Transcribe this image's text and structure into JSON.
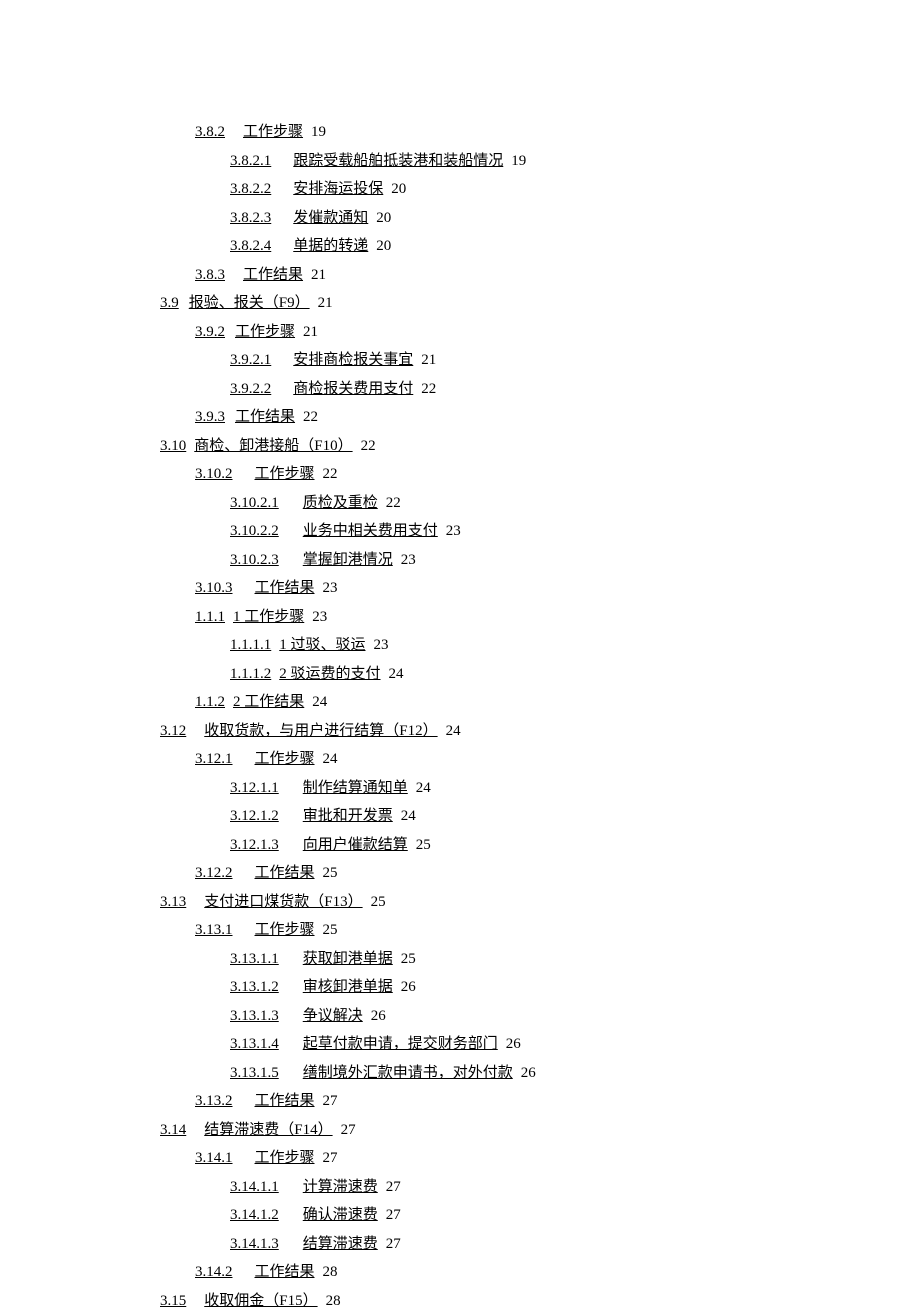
{
  "toc": [
    {
      "indent": 1,
      "num": "3.8.2",
      "gap": 18,
      "label": "工作步骤",
      "page": "19"
    },
    {
      "indent": 2,
      "num": "3.8.2.1",
      "gap": 22,
      "label": "跟踪受载船舶抵装港和装船情况",
      "page": "19"
    },
    {
      "indent": 2,
      "num": "3.8.2.2",
      "gap": 22,
      "label": "安排海运投保",
      "page": "20"
    },
    {
      "indent": 2,
      "num": "3.8.2.3",
      "gap": 22,
      "label": "发催款通知",
      "page": "20"
    },
    {
      "indent": 2,
      "num": "3.8.2.4",
      "gap": 22,
      "label": "单据的转递",
      "page": "20"
    },
    {
      "indent": 1,
      "num": "3.8.3",
      "gap": 18,
      "label": "工作结果",
      "page": "21"
    },
    {
      "indent": 0,
      "num": "3.9",
      "gap": 10,
      "label": "报验、报关（F9）",
      "page": "21"
    },
    {
      "indent": 1,
      "num": "3.9.2",
      "gap": 10,
      "label": "工作步骤",
      "page": "21"
    },
    {
      "indent": 2,
      "num": "3.9.2.1",
      "gap": 22,
      "label": "安排商检报关事宜",
      "page": "21"
    },
    {
      "indent": 2,
      "num": "3.9.2.2",
      "gap": 22,
      "label": "商检报关费用支付",
      "page": "22"
    },
    {
      "indent": 1,
      "num": "3.9.3",
      "gap": 10,
      "label": "工作结果",
      "page": "22"
    },
    {
      "indent": 0,
      "num": "3.10",
      "gap": 8,
      "label": "商检、卸港接船（F10）",
      "page": "22"
    },
    {
      "indent": 1,
      "num": "3.10.2",
      "gap": 22,
      "label": "工作步骤",
      "page": "22"
    },
    {
      "indent": 2,
      "num": "3.10.2.1",
      "gap": 24,
      "label": "质检及重检",
      "page": "22"
    },
    {
      "indent": 2,
      "num": "3.10.2.2",
      "gap": 24,
      "label": "业务中相关费用支付",
      "page": "23"
    },
    {
      "indent": 2,
      "num": "3.10.2.3",
      "gap": 24,
      "label": "掌握卸港情况",
      "page": "23"
    },
    {
      "indent": 1,
      "num": "3.10.3",
      "gap": 22,
      "label": "工作结果",
      "page": "23"
    },
    {
      "indent": 1,
      "num": "1.1.1",
      "gap": 8,
      "label": "1 工作步骤",
      "page": "23"
    },
    {
      "indent": 2,
      "num": "1.1.1.1",
      "gap": 8,
      "label": "1 过驳、驳运",
      "page": "23"
    },
    {
      "indent": 2,
      "num": "1.1.1.2",
      "gap": 8,
      "label": "2 驳运费的支付",
      "page": "24"
    },
    {
      "indent": 1,
      "num": "1.1.2",
      "gap": 8,
      "label": "2 工作结果",
      "page": "24"
    },
    {
      "indent": 0,
      "num": "3.12",
      "gap": 18,
      "label": "收取货款，与用户进行结算（F12）",
      "page": "24"
    },
    {
      "indent": 1,
      "num": "3.12.1",
      "gap": 22,
      "label": "工作步骤",
      "page": "24"
    },
    {
      "indent": 2,
      "num": "3.12.1.1",
      "gap": 24,
      "label": "制作结算通知单",
      "page": "24"
    },
    {
      "indent": 2,
      "num": "3.12.1.2",
      "gap": 24,
      "label": "审批和开发票",
      "page": "24"
    },
    {
      "indent": 2,
      "num": "3.12.1.3",
      "gap": 24,
      "label": "向用户催款结算",
      "page": "25"
    },
    {
      "indent": 1,
      "num": "3.12.2",
      "gap": 22,
      "label": "工作结果",
      "page": "25"
    },
    {
      "indent": 0,
      "num": "3.13",
      "gap": 18,
      "label": "支付进口煤货款（F13）",
      "page": "25"
    },
    {
      "indent": 1,
      "num": "3.13.1",
      "gap": 22,
      "label": "工作步骤",
      "page": "25"
    },
    {
      "indent": 2,
      "num": "3.13.1.1",
      "gap": 24,
      "label": "获取卸港单据",
      "page": "25"
    },
    {
      "indent": 2,
      "num": "3.13.1.2",
      "gap": 24,
      "label": "审核卸港单据",
      "page": "26"
    },
    {
      "indent": 2,
      "num": "3.13.1.3",
      "gap": 24,
      "label": "争议解决",
      "page": "26"
    },
    {
      "indent": 2,
      "num": "3.13.1.4",
      "gap": 24,
      "label": "起草付款申请，提交财务部门",
      "page": "26"
    },
    {
      "indent": 2,
      "num": "3.13.1.5",
      "gap": 24,
      "label": "缮制境外汇款申请书，对外付款",
      "page": "26"
    },
    {
      "indent": 1,
      "num": "3.13.2",
      "gap": 22,
      "label": "工作结果",
      "page": "27"
    },
    {
      "indent": 0,
      "num": "3.14",
      "gap": 18,
      "label": "结算滞速费（F14）",
      "page": "27"
    },
    {
      "indent": 1,
      "num": "3.14.1",
      "gap": 22,
      "label": "工作步骤",
      "page": "27"
    },
    {
      "indent": 2,
      "num": "3.14.1.1",
      "gap": 24,
      "label": "计算滞速费",
      "page": "27"
    },
    {
      "indent": 2,
      "num": "3.14.1.2",
      "gap": 24,
      "label": "确认滞速费",
      "page": "27"
    },
    {
      "indent": 2,
      "num": "3.14.1.3",
      "gap": 24,
      "label": "结算滞速费",
      "page": "27"
    },
    {
      "indent": 1,
      "num": "3.14.2",
      "gap": 22,
      "label": "工作结果",
      "page": "28"
    },
    {
      "indent": 0,
      "num": "3.15",
      "gap": 18,
      "label": "收取佣金（F15）",
      "page": "28"
    }
  ]
}
